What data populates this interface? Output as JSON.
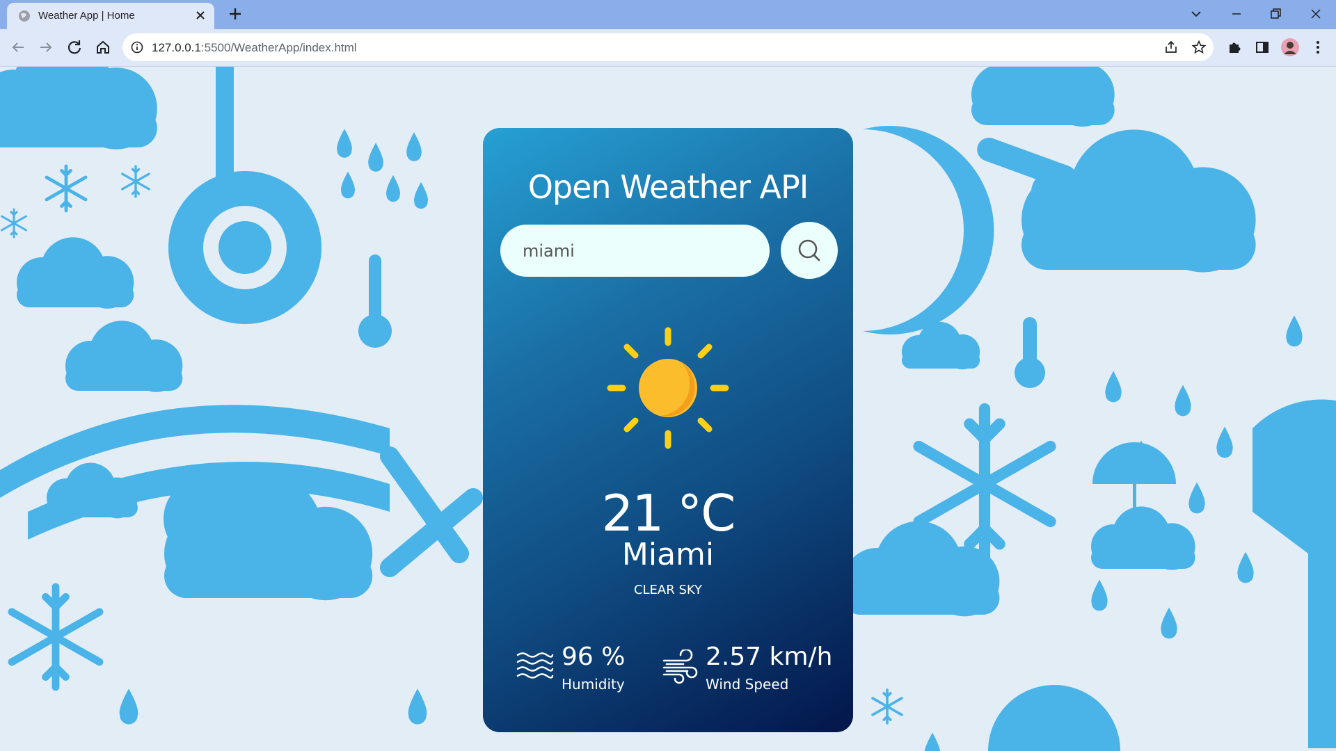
{
  "browser": {
    "tab_title": "Weather App | Home",
    "url_host": "127.0.0.1",
    "url_rest": ":5500/WeatherApp/index.html"
  },
  "app": {
    "title": "Open Weather API",
    "search": {
      "value": "miami",
      "placeholder": "miami"
    },
    "weather_icon": "sun-icon",
    "temperature": "21 °C",
    "city": "Miami",
    "description": "CLEAR SKY",
    "humidity": {
      "value": "96 %",
      "label": "Humidity",
      "icon": "humidity-waves-icon"
    },
    "wind": {
      "value": "2.57 km/h",
      "label": "Wind Speed",
      "icon": "wind-icon"
    }
  },
  "colors": {
    "card_gradient": [
      "#26a0d4",
      "#1a6fa5",
      "#0f4c82",
      "#03164a"
    ],
    "background_pattern": "#4ab3e8",
    "background": "#e3edf5"
  }
}
